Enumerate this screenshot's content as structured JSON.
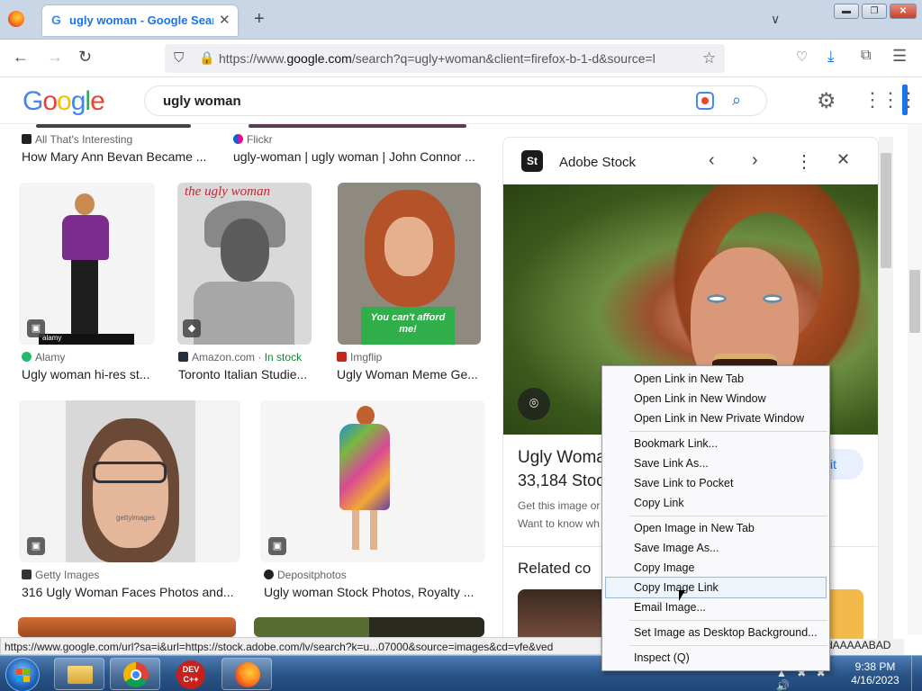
{
  "browser": {
    "tab_title": "ugly woman - Google Search",
    "tab_favicon": "G",
    "tab_close": "✕",
    "new_tab": "+",
    "tab_list": "∨",
    "window_controls": {
      "minimize": "▬",
      "maximize": "❐",
      "close": "✕"
    },
    "url_prefix": "https://www.",
    "url_domain": "google.com",
    "url_rest": "/search?q=ugly+woman&client=firefox-b-1-d&source=l",
    "icons": {
      "back": "←",
      "forward": "→",
      "reload": "↻",
      "shield": "⛉",
      "lock": "🔒",
      "star": "☆",
      "pocket": "♡",
      "download": "⤓",
      "extensions": "⧉",
      "menu": "☰"
    }
  },
  "google": {
    "logo_letters": [
      {
        "ch": "G",
        "color": "#4285f4"
      },
      {
        "ch": "o",
        "color": "#ea4335"
      },
      {
        "ch": "o",
        "color": "#fbbc05"
      },
      {
        "ch": "g",
        "color": "#4285f4"
      },
      {
        "ch": "l",
        "color": "#34a853"
      },
      {
        "ch": "e",
        "color": "#ea4335"
      }
    ],
    "query": "ugly woman",
    "search_icon": "⌕",
    "settings_icon": "⚙",
    "apps_icon": "⋮⋮⋮"
  },
  "results": {
    "row0": [
      {
        "source": "All That's Interesting",
        "title": "How Mary Ann Bevan Became ..."
      },
      {
        "source": "Flickr",
        "title": "ugly-woman | ugly woman | John Connor ..."
      }
    ],
    "row1": [
      {
        "source": "Alamy",
        "title": "Ugly woman hi-res st..."
      },
      {
        "source": "Amazon.com",
        "stock": "In stock",
        "title": "Toronto Italian Studie..."
      },
      {
        "source": "Imgflip",
        "title": "Ugly Woman Meme Ge..."
      }
    ],
    "row2": [
      {
        "source": "Getty Images",
        "title": "316 Ugly Woman Faces Photos and..."
      },
      {
        "source": "Depositphotos",
        "title": "Ugly woman Stock Photos, Royalty ..."
      }
    ],
    "thumb_texts": {
      "ugly_top": "the ugly woman",
      "tank_text": "You can't afford me!",
      "alamy_mark": "alamy",
      "getty_mark": "gettyimages",
      "amazon_dot": "·"
    }
  },
  "panel": {
    "logo": "St",
    "name": "Adobe Stock",
    "prev": "‹",
    "next": "›",
    "more": "⋮",
    "close": "✕",
    "scan_icon": "⌾",
    "title": "Ugly Woma",
    "count": "33,184 Stock",
    "line1": "Get this image or",
    "line2": "Want to know wh",
    "visit": "sit",
    "related": "Related co"
  },
  "status": {
    "text": "https://www.google.com/url?sa=i&url=https://stock.adobe.com/lv/search?k=u...07000&source=images&cd=vfe&ved",
    "tail": "dAAAAABAD"
  },
  "taskbar": {
    "time": "9:38 PM",
    "date": "4/16/2023",
    "devcpp": "DEV C++",
    "tray": "▲ ✖ ✖ 🔊"
  },
  "context_menu": {
    "group1": [
      "Open Link in New Tab",
      "Open Link in New Window",
      "Open Link in New Private Window"
    ],
    "group2": [
      "Bookmark Link...",
      "Save Link As...",
      "Save Link to Pocket",
      "Copy Link"
    ],
    "group3": [
      "Open Image in New Tab",
      "Save Image As...",
      "Copy Image",
      "Copy Image Link",
      "Email Image..."
    ],
    "group4": [
      "Set Image as Desktop Background..."
    ],
    "group5": [
      "Inspect (Q)"
    ]
  }
}
